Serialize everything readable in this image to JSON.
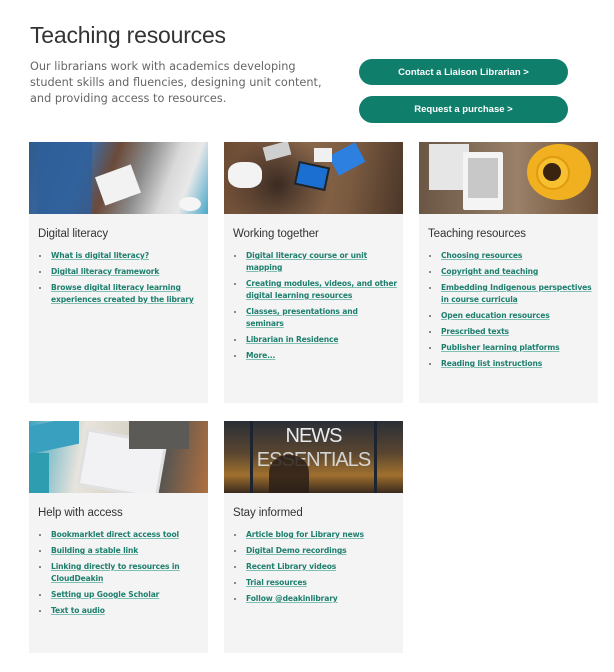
{
  "header": {
    "title": "Teaching resources",
    "intro": "Our librarians work with academics developing student skills and fluencies, designing unit content, and providing access to resources."
  },
  "buttons": {
    "contact": "Contact a Liaison Librarian >",
    "request": "Request a purchase >"
  },
  "colors": {
    "accent": "#0f7f6c",
    "link": "#1e7f6e",
    "card_bg": "#f4f4f4"
  },
  "cards": [
    {
      "title": "Digital literacy",
      "image": "hands-with-tablet-photo",
      "links": [
        "What is digital literacy?",
        "Digital literacy framework",
        "Browse digital literacy learning experiences created by the library"
      ]
    },
    {
      "title": "Working together",
      "image": "group-with-laptops-photo",
      "links": [
        "Digital literacy course or unit mapping",
        "Creating modules, videos, and other digital learning resources",
        "Classes, presentations and seminars",
        "Librarian in Residence",
        "More..."
      ]
    },
    {
      "title": "Teaching resources",
      "image": "ereader-and-coffee-photo",
      "links": [
        "Choosing resources",
        "Copyright and teaching",
        "Embedding Indigenous perspectives in course curricula",
        "Open education resources",
        "Prescribed texts",
        "Publisher learning platforms",
        "Reading list instructions"
      ]
    },
    {
      "title": "Help with access",
      "image": "tablet-on-desk-photo",
      "links": [
        "Bookmarklet direct access tool",
        "Building a stable link",
        "Linking directly to resources in CloudDeakin",
        "Setting up Google Scholar",
        "Text to audio"
      ]
    },
    {
      "title": "Stay informed",
      "image": "news-essentials-sign-photo",
      "image_text": [
        "NEWS",
        "ESSENTIALS"
      ],
      "links": [
        "Article blog for Library news",
        "Digital Demo recordings",
        "Recent Library videos",
        "Trial resources",
        "Follow @deakinlibrary"
      ]
    }
  ]
}
